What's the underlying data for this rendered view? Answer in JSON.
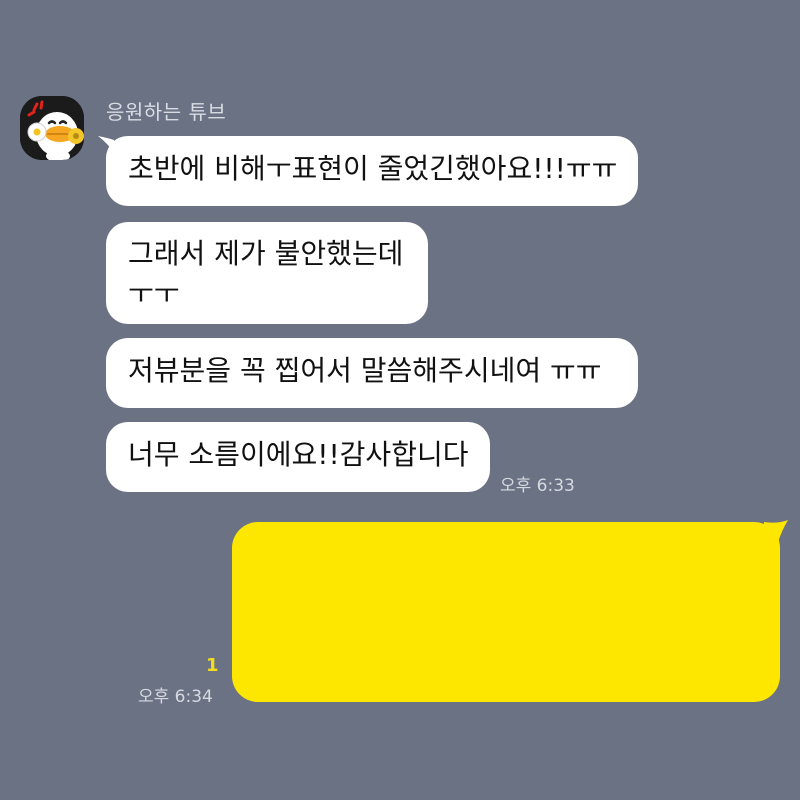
{
  "sender": {
    "name": "응원하는 튜브",
    "avatar_icon": "duck-character-icon"
  },
  "incoming": {
    "messages": [
      "초반에 비해ㅜ표현이 줄었긴했아요!!!ㅠㅠ",
      "그래서 제가 불안했는데 ㅜㅜ",
      " 저뷰분을 꼭 찝어서 말씀해주시네여 ㅠㅠ",
      "너무 소름이에요!!감사합니다"
    ],
    "time": "오후 6:33"
  },
  "outgoing": {
    "read_count": "1",
    "time": "오후 6:34",
    "bubble_color": "#fde700"
  },
  "colors": {
    "background": "#6b7283",
    "incoming_bubble": "#ffffff"
  }
}
